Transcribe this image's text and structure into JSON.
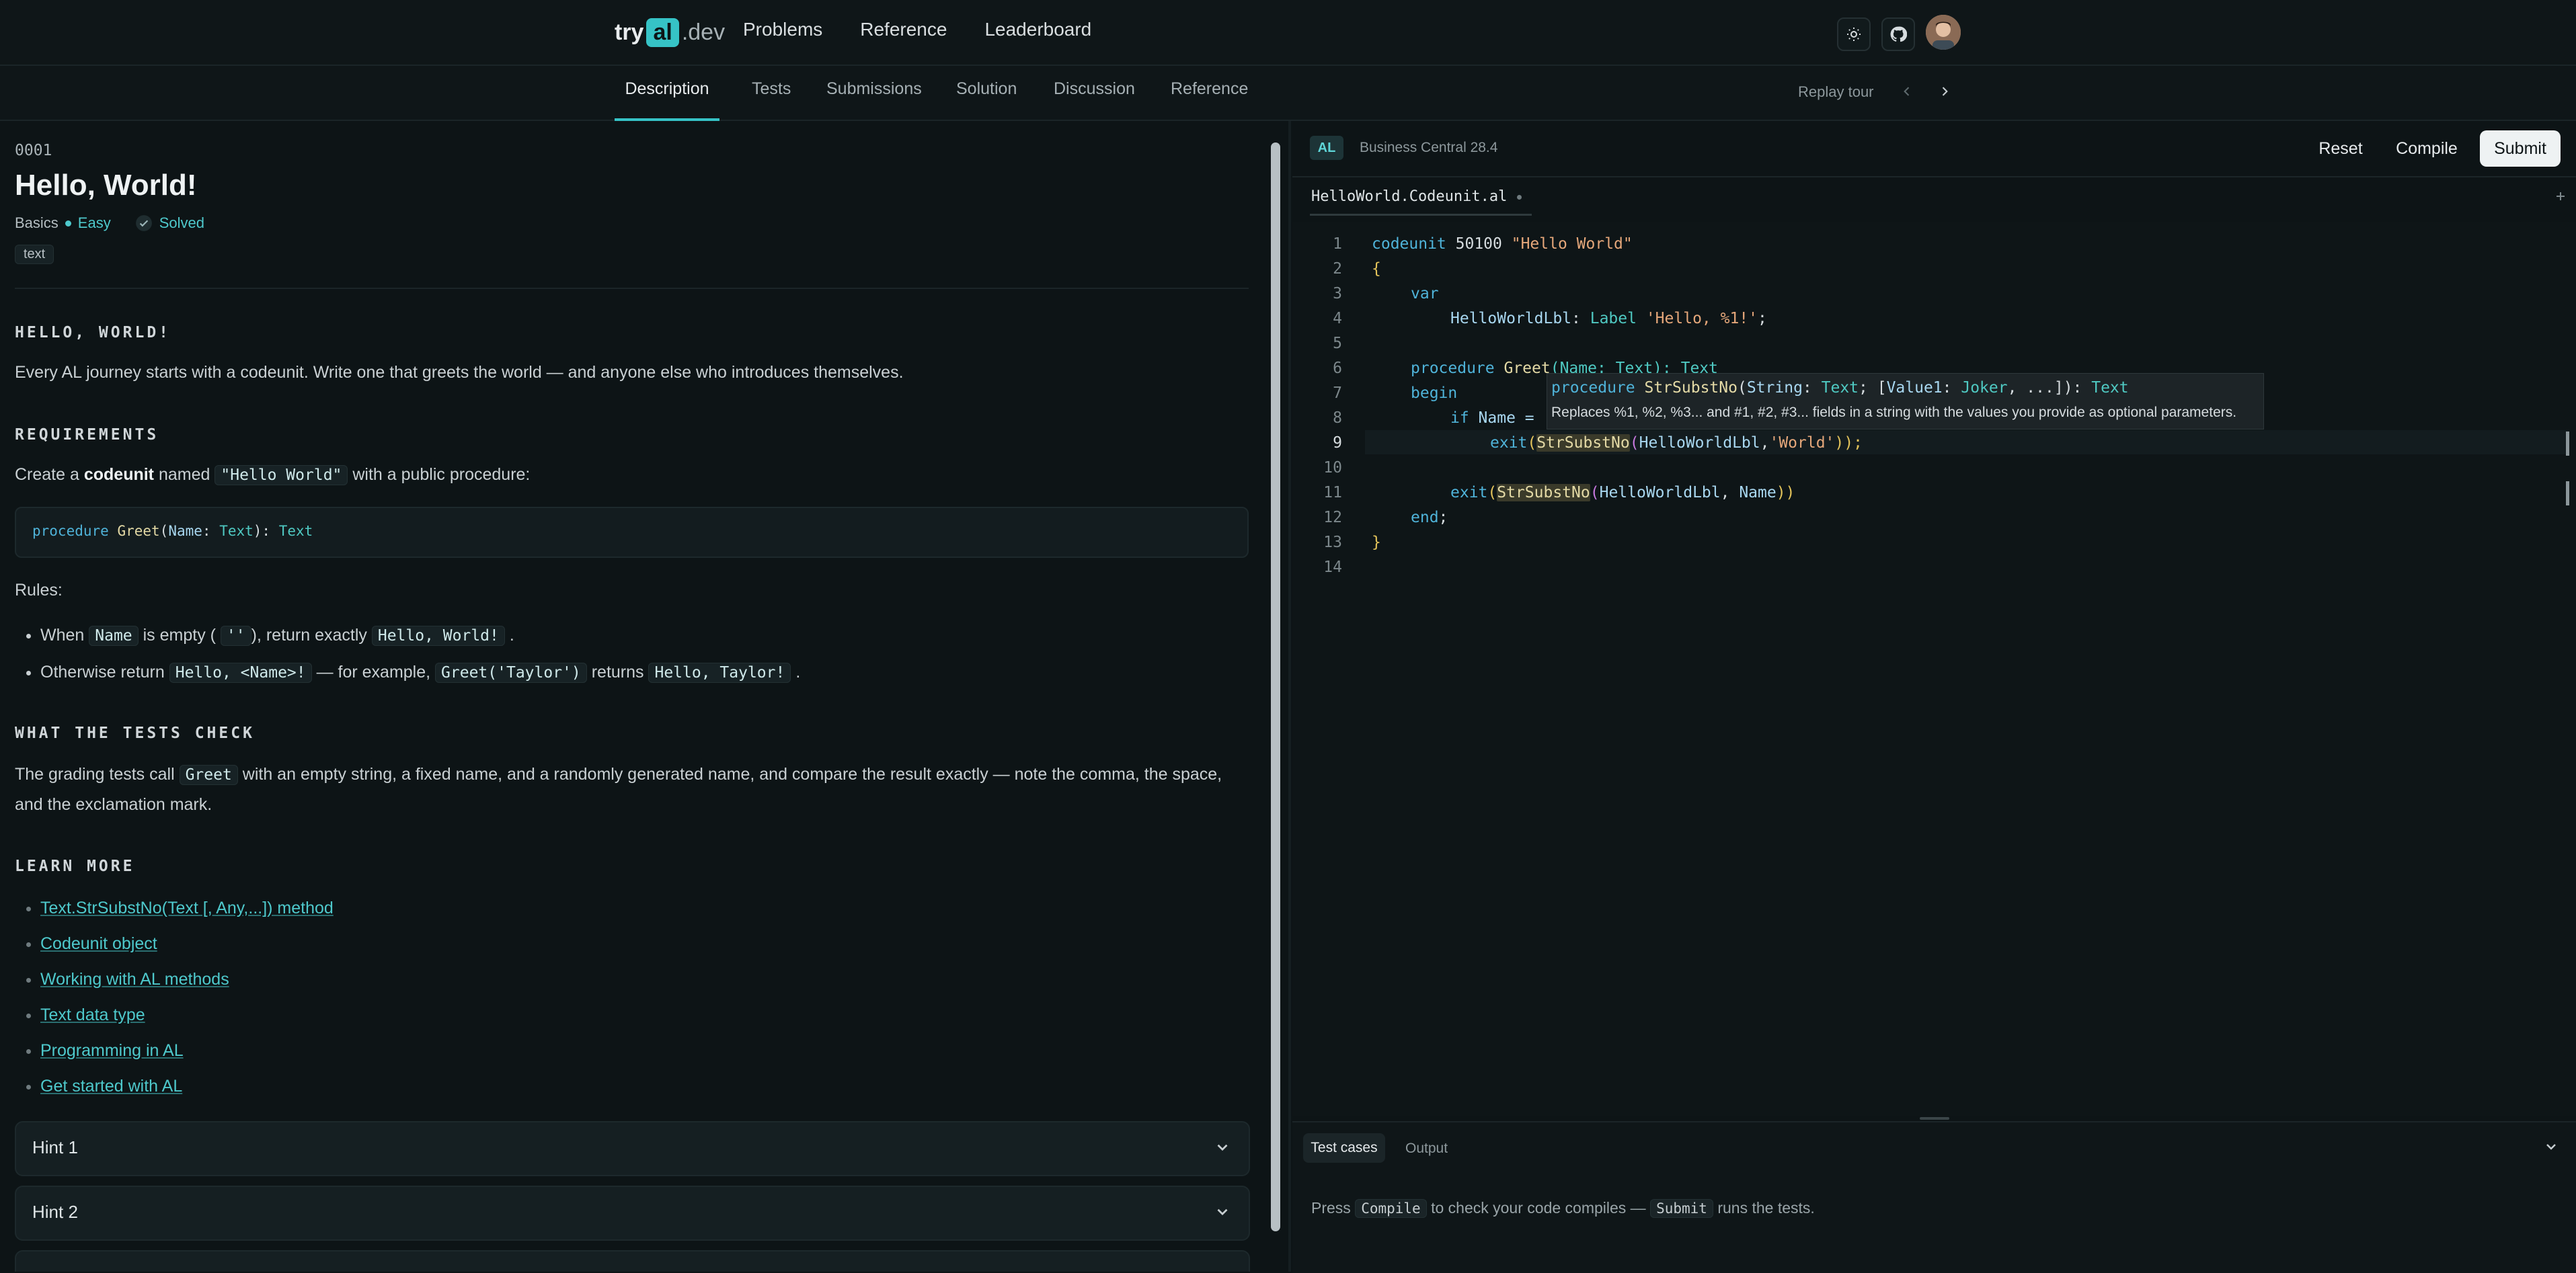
{
  "nav": {
    "logo_try": "try",
    "logo_al": "al",
    "logo_dev": ".dev",
    "links": [
      "Problems",
      "Reference",
      "Leaderboard"
    ]
  },
  "tabs": [
    "Description",
    "Tests",
    "Submissions",
    "Solution",
    "Discussion",
    "Reference"
  ],
  "replay_tour": "Replay tour",
  "problem": {
    "id": "0001",
    "title": "Hello, World!",
    "category": "Basics",
    "difficulty": "Easy",
    "status": "Solved",
    "tag": "text",
    "section1_heading": "HELLO, WORLD!",
    "intro": "Every AL journey starts with a codeunit. Write one that greets the world — and anyone else who introduces themselves.",
    "req_heading": "REQUIREMENTS",
    "req_pre": "Create a",
    "req_codeunit": "codeunit",
    "req_named": "named",
    "req_name_code": "\"Hello World\"",
    "req_post": "with a public procedure:",
    "sig_procedure": "procedure",
    "sig_fn": "Greet",
    "sig_open": "(",
    "sig_param": "Name",
    "sig_colon": ": ",
    "sig_type": "Text",
    "sig_close": "): ",
    "sig_ret": "Text",
    "rules_label": "Rules:",
    "rule1_a": "When",
    "rule1_code1": "Name",
    "rule1_b": "is empty (",
    "rule1_code2": "''",
    "rule1_c": "), return exactly",
    "rule1_code3": "Hello, World!",
    "rule1_d": ".",
    "rule2_a": "Otherwise return",
    "rule2_code1": "Hello, <Name>!",
    "rule2_b": "— for example,",
    "rule2_code2": "Greet('Taylor')",
    "rule2_c": "returns",
    "rule2_code3": "Hello, Taylor!",
    "rule2_d": ".",
    "tests_heading": "WHAT THE TESTS CHECK",
    "tests_a": "The grading tests call",
    "tests_code": "Greet",
    "tests_b": "with an empty string, a fixed name, and a randomly generated name, and compare the result exactly — note the comma, the space, and the exclamation mark.",
    "learn_heading": "LEARN MORE",
    "links": [
      "Text.StrSubstNo(Text [, Any,...]) method",
      "Codeunit object",
      "Working with AL methods",
      "Text data type",
      "Programming in AL",
      "Get started with AL"
    ],
    "hints": [
      "Hint 1",
      "Hint 2"
    ]
  },
  "editor": {
    "lang_badge": "AL",
    "version": "Business Central 28.4",
    "buttons": {
      "reset": "Reset",
      "compile": "Compile",
      "submit": "Submit"
    },
    "file_tab": "HelloWorld.Codeunit.al",
    "line_numbers": [
      "1",
      "2",
      "3",
      "4",
      "5",
      "6",
      "7",
      "8",
      "9",
      "10",
      "11",
      "12",
      "13",
      "14"
    ],
    "code": {
      "l1_kw": "codeunit",
      "l1_num": " 50100 ",
      "l1_str": "\"Hello World\"",
      "l2": "{",
      "l3_kw": "var",
      "l4_id": "HelloWorldLbl",
      "l4_colon": ": ",
      "l4_type": "Label",
      "l4_str": "'Hello, %1!'",
      "l4_semi": ";",
      "l6_kw": "procedure",
      "l6_fn": "Greet",
      "l6_rest": "(Name: Text): Text",
      "l7_kw": "begin",
      "l8_kw": "if",
      "l8_rest": " Name =",
      "l9_exit": "exit",
      "l9_open": "(",
      "l9_fn": "StrSubstNo",
      "l9_args_open": "(",
      "l9_id": "HelloWorldLbl",
      "l9_comma": ",",
      "l9_str": "'World'",
      "l9_close": "));",
      "l11_exit": "exit",
      "l11_open": "(",
      "l11_fn": "StrSubstNo",
      "l11_args": "(",
      "l11_id": "HelloWorldLbl",
      "l11_comma": ", ",
      "l11_name": "Name",
      "l11_close": "))",
      "l12_kw": "end",
      "l12_semi": ";",
      "l13": "}"
    },
    "tooltip": {
      "kw": "procedure",
      "fn": "StrSubstNo",
      "open": "(",
      "p1": "String",
      "c1": ": ",
      "t1": "Text",
      "mid": "; [",
      "p2": "Value1",
      "c2": ": ",
      "t2": "Joker",
      "rest": ", ...]): ",
      "ret": "Text",
      "doc": "Replaces %1, %2, %3... and #1, #2, #3... fields in a string with the values you provide as optional parameters."
    }
  },
  "panel": {
    "tabs": [
      "Test cases",
      "Output"
    ],
    "msg_a": "Press",
    "msg_code1": "Compile",
    "msg_b": "to check your code compiles —",
    "msg_code2": "Submit",
    "msg_c": "runs the tests."
  },
  "colors": {
    "accent": "#36c3c6",
    "background": "#0d1416",
    "easy": "#4ec9cc",
    "link": "#4ec9cc"
  },
  "icons": [
    "sun-icon",
    "github-icon",
    "chevron-left-icon",
    "chevron-right-icon",
    "check-circle-icon",
    "chevron-down-icon",
    "plus-icon",
    "avatar"
  ]
}
